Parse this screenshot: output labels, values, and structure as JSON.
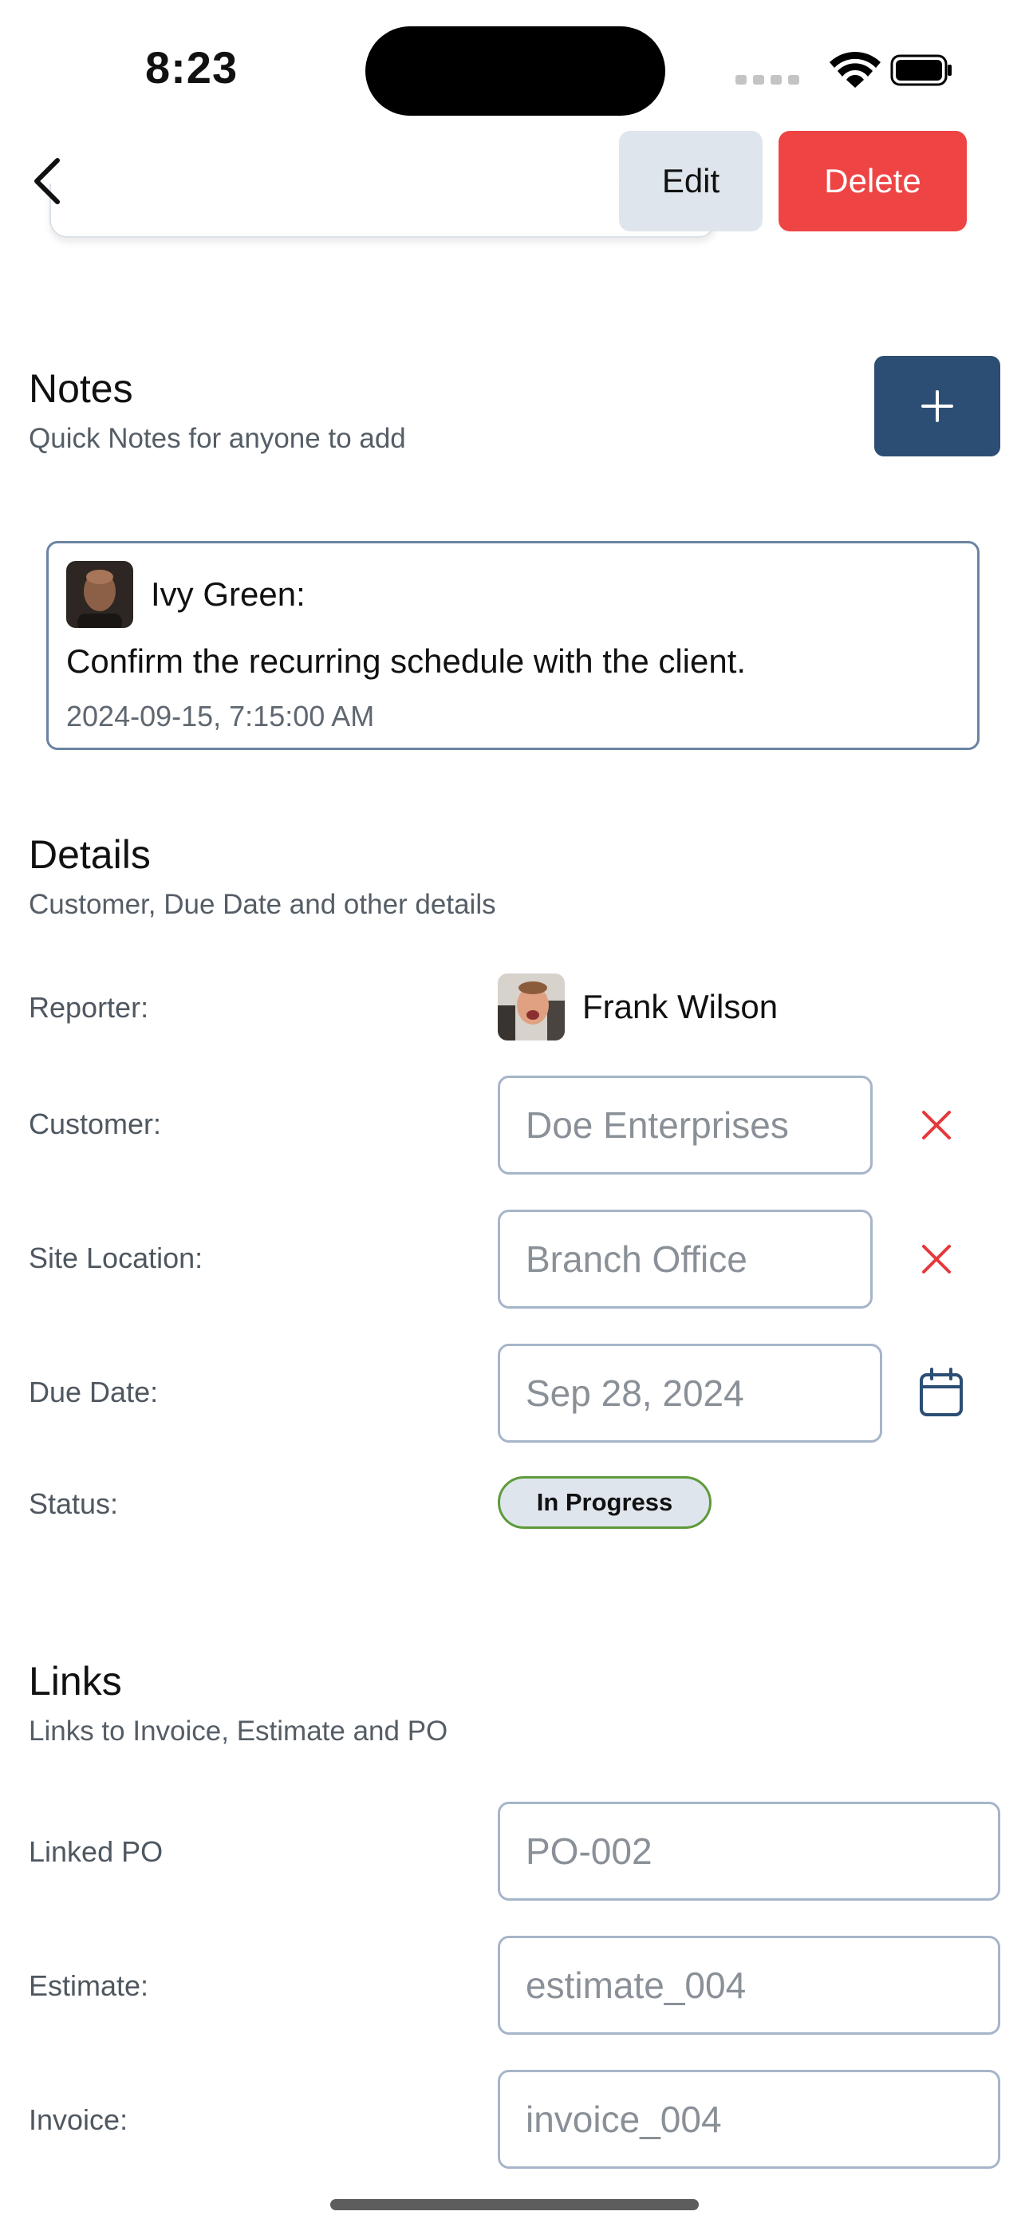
{
  "status_bar": {
    "time": "8:23"
  },
  "top_bar": {
    "edit_label": "Edit",
    "delete_label": "Delete"
  },
  "notes": {
    "title": "Notes",
    "subtitle": "Quick Notes for anyone to add",
    "items": [
      {
        "author": "Ivy Green:",
        "text": "Confirm the recurring schedule with the client.",
        "timestamp": "2024-09-15, 7:15:00 AM"
      }
    ]
  },
  "details": {
    "title": "Details",
    "subtitle": "Customer, Due Date and other details",
    "reporter_label": "Reporter:",
    "reporter_name": "Frank Wilson",
    "customer_label": "Customer:",
    "customer_value": "Doe Enterprises",
    "site_location_label": "Site Location:",
    "site_location_value": "Branch Office",
    "due_date_label": "Due Date:",
    "due_date_value": "Sep 28, 2024",
    "status_label": "Status:",
    "status_value": "In Progress"
  },
  "links": {
    "title": "Links",
    "subtitle": "Links to Invoice, Estimate and PO",
    "linked_po_label": "Linked PO",
    "linked_po_value": "PO-002",
    "estimate_label": "Estimate:",
    "estimate_value": "estimate_004",
    "invoice_label": "Invoice:",
    "invoice_value": "invoice_004"
  },
  "colors": {
    "delete": "#ef4444",
    "edit": "#dfe5ec",
    "add_button": "#2c4e74",
    "clear_icon": "#e5383b",
    "calendar_icon": "#2c4e74",
    "status_border": "#5e9a3b",
    "field_border": "#a6b5c9"
  },
  "icons": {
    "back": "chevron-left-icon",
    "add": "plus-icon",
    "clear": "close-icon",
    "calendar": "calendar-icon"
  }
}
